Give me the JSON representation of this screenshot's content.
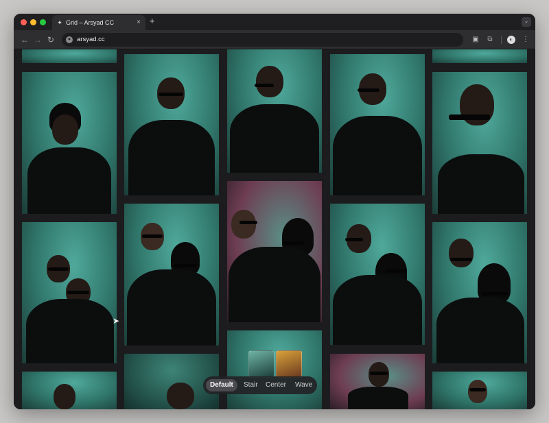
{
  "browser": {
    "tab_title": "Grid – Arsyad CC",
    "tab_favicon": "figma-logo-icon",
    "tab_close": "×",
    "new_tab": "+",
    "url": "arsyad.cc",
    "nav": {
      "back": "←",
      "forward": "→",
      "reload": "↻"
    },
    "toolbar_icons": {
      "ext1": "▣",
      "extensions": "⧉",
      "profile": "◐",
      "menu": "⋮",
      "tab_menu": "⌄"
    }
  },
  "gallery": {
    "layout_switcher": {
      "selected": "Default",
      "options": [
        "Default",
        "Stair",
        "Center",
        "Wave"
      ]
    }
  },
  "colors": {
    "teal": "#2f7469",
    "background": "#1c1c1e",
    "switcher_active": "#4a4a4f"
  }
}
